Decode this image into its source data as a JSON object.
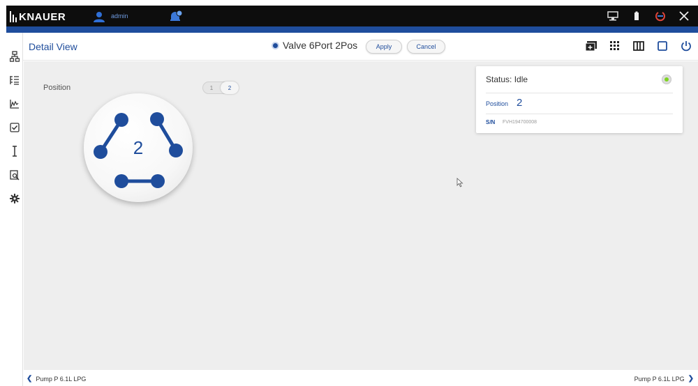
{
  "topbar": {
    "logo_text": "KNAUER",
    "user": "admin",
    "icons": [
      "user-icon",
      "notification-bell-icon",
      "network-icon",
      "battery-icon",
      "power-status-icon",
      "close-icon"
    ]
  },
  "header": {
    "title": "Detail View",
    "device": "Valve 6Port 2Pos",
    "apply_label": "Apply",
    "cancel_label": "Cancel",
    "icons": [
      "add-panel-icon",
      "grid-icon",
      "columns-icon",
      "window-icon",
      "power-icon"
    ]
  },
  "rail": {
    "icons": [
      "flow-diagram-icon",
      "method-list-icon",
      "chart-icon",
      "checklist-icon",
      "text-cursor-icon",
      "search-document-icon",
      "settings-icon"
    ]
  },
  "main": {
    "position_label": "Position",
    "position_options": [
      "1",
      "2"
    ],
    "selected_position": "2",
    "valve_display": "2"
  },
  "status_card": {
    "status_text": "Status: Idle",
    "position_label": "Position",
    "position_value": "2",
    "sn_label": "S/N",
    "sn_value": "FVH194700008"
  },
  "footer": {
    "prev_device": "Pump P 6.1L LPG",
    "next_device": "Pump P 6.1L LPG"
  },
  "colors": {
    "accent": "#1f4d9c",
    "topbar": "#0d0d0d",
    "content_bg": "#eeeeee",
    "status_ok": "#7ed321"
  }
}
